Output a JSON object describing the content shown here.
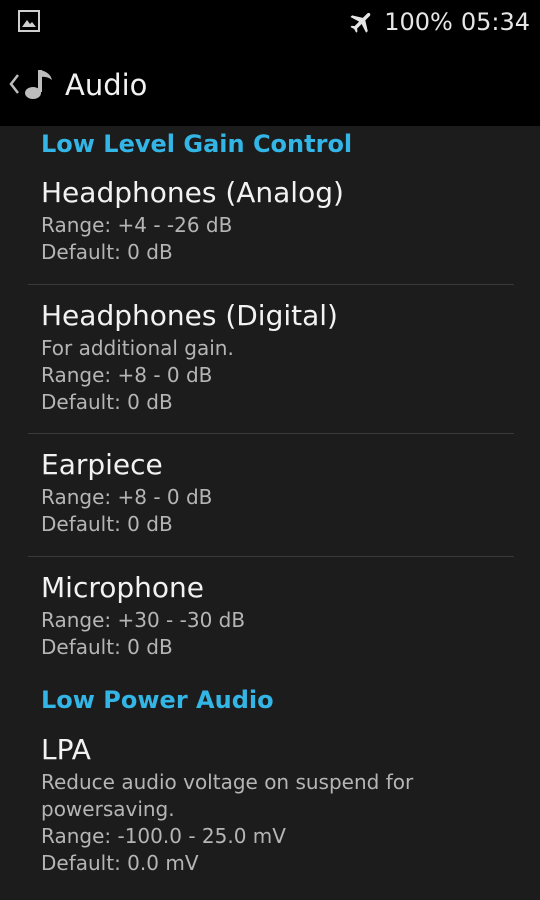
{
  "status_bar": {
    "battery": "100%",
    "time": "05:34",
    "icons": [
      "gallery-icon",
      "airplane-mode-icon"
    ]
  },
  "action_bar": {
    "title": "Audio",
    "icons": [
      "back-arrow-icon",
      "music-note-icon"
    ]
  },
  "sections": [
    {
      "header": "Low Level Gain Control"
    },
    {
      "header": "Low Power Audio"
    }
  ],
  "prefs": [
    {
      "title": "Headphones (Analog)",
      "lines": [
        "Range: +4 - -26 dB",
        "Default: 0 dB"
      ]
    },
    {
      "title": "Headphones (Digital)",
      "lines": [
        "For additional gain.",
        "Range: +8 - 0 dB",
        "Default: 0 dB"
      ]
    },
    {
      "title": "Earpiece",
      "lines": [
        "Range: +8 - 0 dB",
        "Default: 0 dB"
      ]
    },
    {
      "title": "Microphone",
      "lines": [
        "Range: +30 - -30 dB",
        "Default: 0 dB"
      ]
    },
    {
      "title": "LPA",
      "lines": [
        "Reduce audio voltage on suspend for",
        "powersaving.",
        "Range: -100.0 - 25.0 mV",
        "Default: 0.0 mV"
      ]
    }
  ],
  "colors": {
    "accent": "#33b5e5",
    "background": "#1c1c1c",
    "bars": "#000000"
  }
}
